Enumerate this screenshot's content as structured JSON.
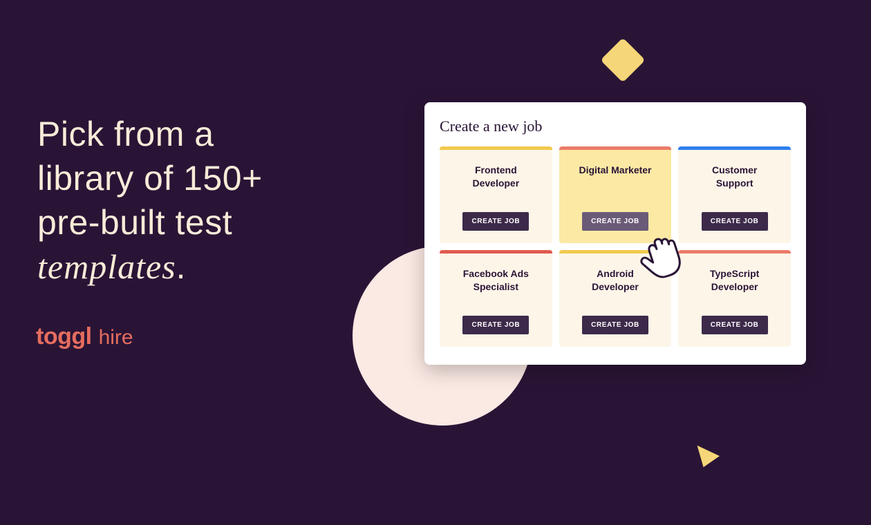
{
  "colors": {
    "background": "#2a1436",
    "headline_text": "#f7ecd8",
    "accent_yellow": "#f5d678",
    "accent_circle": "#fbe9e4",
    "brand": "#e66d5e",
    "card_cream": "#fdf6e8",
    "card_highlight": "#fbe9a4",
    "button_bg": "#3d2a4a",
    "button_bg_hover": "#6b5a77",
    "top_yellow": "#f2c94c",
    "top_salmon": "#eb7b6a",
    "top_blue": "#2f80ed",
    "top_red": "#e05a4f"
  },
  "headline": {
    "line1": "Pick from a",
    "line2": "library of 150+",
    "line3": "pre-built test",
    "line4_italic": "templates",
    "line4_tail": "."
  },
  "logo": {
    "brand": "toggl",
    "product": "hire"
  },
  "panel": {
    "title": "Create a new job",
    "create_label": "CREATE JOB"
  },
  "jobs": [
    {
      "title": "Frontend\nDeveloper",
      "top": "yellow",
      "bg": "cream",
      "hover": false
    },
    {
      "title": "Digital Marketer",
      "top": "salmon",
      "bg": "highlight",
      "hover": true
    },
    {
      "title": "Customer\nSupport",
      "top": "blue",
      "bg": "cream",
      "hover": false
    },
    {
      "title": "Facebook Ads\nSpecialist",
      "top": "red",
      "bg": "cream",
      "hover": false
    },
    {
      "title": "Android\nDeveloper",
      "top": "yellow",
      "bg": "cream",
      "hover": false
    },
    {
      "title": "TypeScript\nDeveloper",
      "top": "salmon",
      "bg": "cream",
      "hover": false
    }
  ]
}
